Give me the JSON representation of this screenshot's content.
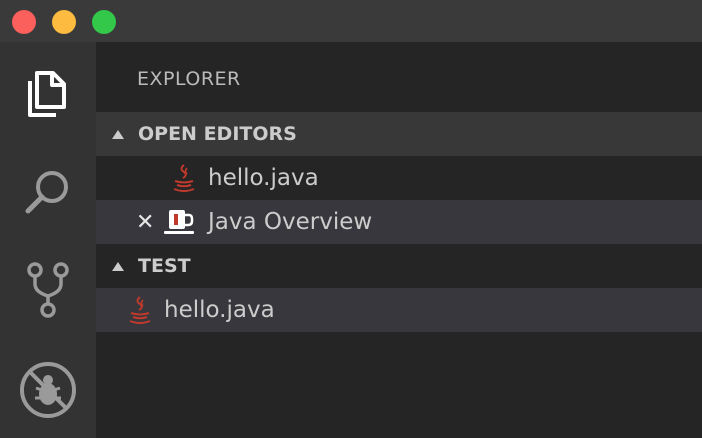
{
  "window": {
    "controls": [
      "close",
      "minimize",
      "maximize"
    ]
  },
  "activity_bar": {
    "items": [
      {
        "name": "explorer",
        "icon": "files-icon",
        "active": true
      },
      {
        "name": "search",
        "icon": "search-icon",
        "active": false
      },
      {
        "name": "source-control",
        "icon": "source-control-icon",
        "active": false
      },
      {
        "name": "debug",
        "icon": "debug-icon",
        "active": false
      }
    ]
  },
  "sidebar": {
    "title": "EXPLORER",
    "open_editors": {
      "label": "OPEN EDITORS",
      "items": [
        {
          "label": "hello.java",
          "icon": "java-icon"
        },
        {
          "label": "Java Overview",
          "icon": "cup-icon",
          "close_glyph": "✕"
        }
      ]
    },
    "folder": {
      "label": "TEST",
      "items": [
        {
          "label": "hello.java",
          "icon": "java-icon"
        }
      ]
    }
  },
  "colors": {
    "java_icon": "#c0392b",
    "selection": "#37373d",
    "section_bg": "#383838"
  }
}
